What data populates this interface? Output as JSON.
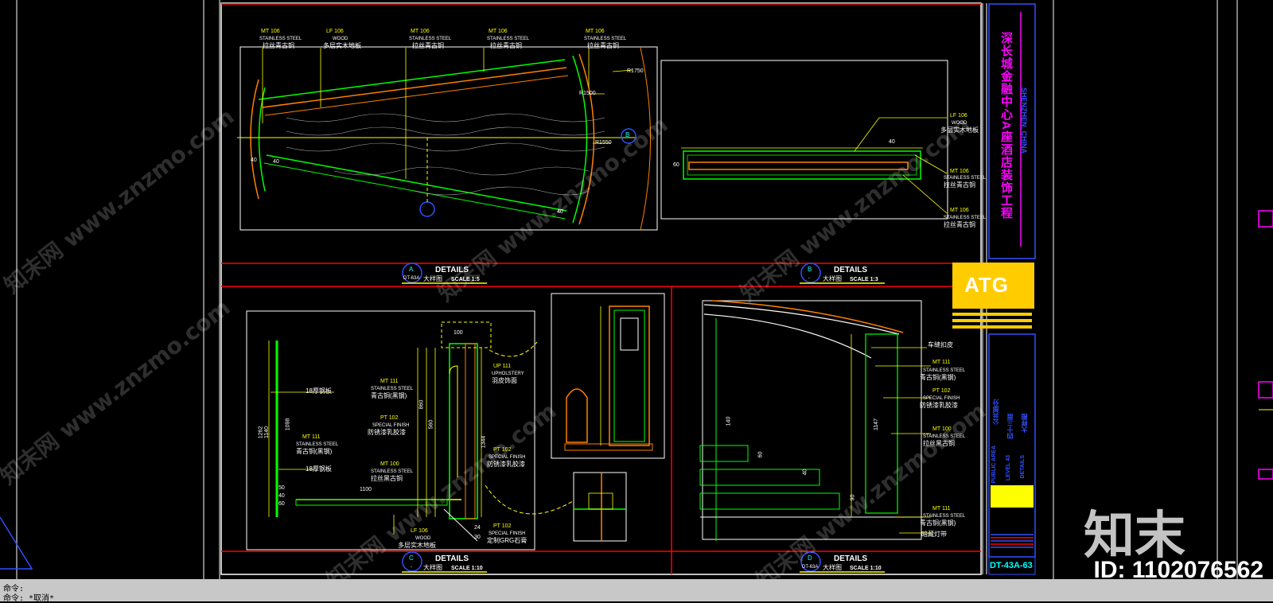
{
  "colors": {
    "background": "#000000",
    "cyan": "#00ffff",
    "yellow": "#ffff00",
    "green": "#00ff00",
    "red": "#ff0000",
    "orange": "#ff8000",
    "magenta": "#ff00ff",
    "blue": "#3050ff",
    "white": "#ffffff",
    "gray": "#7f7f7f",
    "atg": "#ffcc00"
  },
  "detail_a": {
    "circle": "A",
    "title": "DETAILS",
    "sheet": "DT-63A",
    "cn": "大样图",
    "scale": "SCALE 1:5",
    "tags": [
      {
        "code": "MT",
        "num": "106",
        "en": "STAINLESS STEEL",
        "cn": "拉丝青古铜"
      },
      {
        "code": "LF",
        "num": "106",
        "en": "WOOD",
        "cn": "多层实木地板"
      },
      {
        "code": "MT",
        "num": "106",
        "en": "STAINLESS STEEL",
        "cn": "拉丝青古铜"
      },
      {
        "code": "MT",
        "num": "106",
        "en": "STAINLESS STEEL",
        "cn": "拉丝青古铜"
      },
      {
        "code": "MT",
        "num": "106",
        "en": "STAINLESS STEEL",
        "cn": "拉丝青古铜"
      }
    ],
    "dims": [
      "R1750",
      "R1500",
      "R1550",
      "40",
      "40",
      "40"
    ],
    "section_mark": "B"
  },
  "detail_b": {
    "circle": "B",
    "title": "DETAILS",
    "sheet": "-",
    "cn": "大样图",
    "scale": "SCALE 1:3",
    "tags": [
      {
        "code": "LF",
        "num": "106",
        "en": "WOOD",
        "cn": "多层实木地板"
      },
      {
        "code": "MT",
        "num": "106",
        "en": "STAINLESS STEEL",
        "cn": "拉丝青古铜"
      },
      {
        "code": "MT",
        "num": "106",
        "en": "STAINLESS STEEL",
        "cn": "拉丝青古铜"
      }
    ],
    "dims": [
      "40",
      "60"
    ]
  },
  "detail_c": {
    "circle": "C",
    "title": "DETAILS",
    "sheet": "-",
    "cn": "大样图",
    "scale": "SCALE 1:10",
    "tags": [
      {
        "code": "MT",
        "num": "111",
        "en": "STAINLESS STEEL",
        "cn": "青古铜(黑钢)"
      },
      {
        "code": "PT",
        "num": "102",
        "en": "SPECIAL FINISH",
        "cn": "防锈漆乳胶漆"
      },
      {
        "code": "MT",
        "num": "111",
        "en": "STAINLESS STEEL",
        "cn": "青古铜(黑钢)"
      },
      {
        "code": "MT",
        "num": "100",
        "en": "STAINLESS STEEL",
        "cn": "拉丝黑古铜"
      },
      {
        "code": "UP",
        "num": "111",
        "en": "UPHOLSTERY",
        "cn": "羽皮饰面"
      },
      {
        "code": "PT",
        "num": "102",
        "en": "SPECIAL FINISH",
        "cn": "防锈漆乳胶漆"
      },
      {
        "code": "PT",
        "num": "102",
        "en": "SPECIAL FINISH",
        "cn": "定制GRG石膏"
      },
      {
        "code": "LF",
        "num": "106",
        "en": "WOOD",
        "cn": "多层实木地板"
      }
    ],
    "notes": [
      "18厚钢板",
      "18厚钢板"
    ],
    "dims": [
      "1262",
      "1140",
      "1098",
      "50",
      "40",
      "60",
      "1100",
      "860",
      "100",
      "560",
      "1344",
      "24",
      "30"
    ]
  },
  "detail_d": {
    "circle": "D",
    "title": "DETAILS",
    "sheet": "DT-63A",
    "cn": "大样图",
    "scale": "SCALE 1:10",
    "tags": [
      {
        "code": "",
        "num": "",
        "en": "",
        "cn": "车缝扣皮"
      },
      {
        "code": "MT",
        "num": "111",
        "en": "STAINLESS STEEL",
        "cn": "青古铜(黑钢)"
      },
      {
        "code": "PT",
        "num": "102",
        "en": "SPECIAL FINISH",
        "cn": "防锈漆乳胶漆"
      },
      {
        "code": "MT",
        "num": "100",
        "en": "STAINLESS STEEL",
        "cn": "拉丝黑古铜"
      },
      {
        "code": "MT",
        "num": "111",
        "en": "STAINLESS STEEL",
        "cn": "青古铜(黑钢)"
      },
      {
        "code": "",
        "num": "",
        "en": "",
        "cn": "暗藏灯带"
      }
    ],
    "dims": [
      "1147",
      "140",
      "60",
      "40",
      "90"
    ]
  },
  "title_block": {
    "project_cn": "深长城金融中心A座酒店装饰工程",
    "project_en": "SHENZHEN, CHINA",
    "logo": "ATG",
    "area_en": "PUBLIC AREA",
    "area_cn": "公共部分",
    "level_en": "LEVEL 43",
    "level_cn": "四十三层",
    "type_en": "DETAILS",
    "type_cn": "大样图",
    "drawing_no": "DT-43A-63"
  },
  "command_line": {
    "line1": "命令:",
    "line2": "命令: *取消*"
  },
  "watermark": {
    "logo": "知末",
    "id": "ID: 1102076562",
    "site": "知末网 www.znzmo.com"
  }
}
